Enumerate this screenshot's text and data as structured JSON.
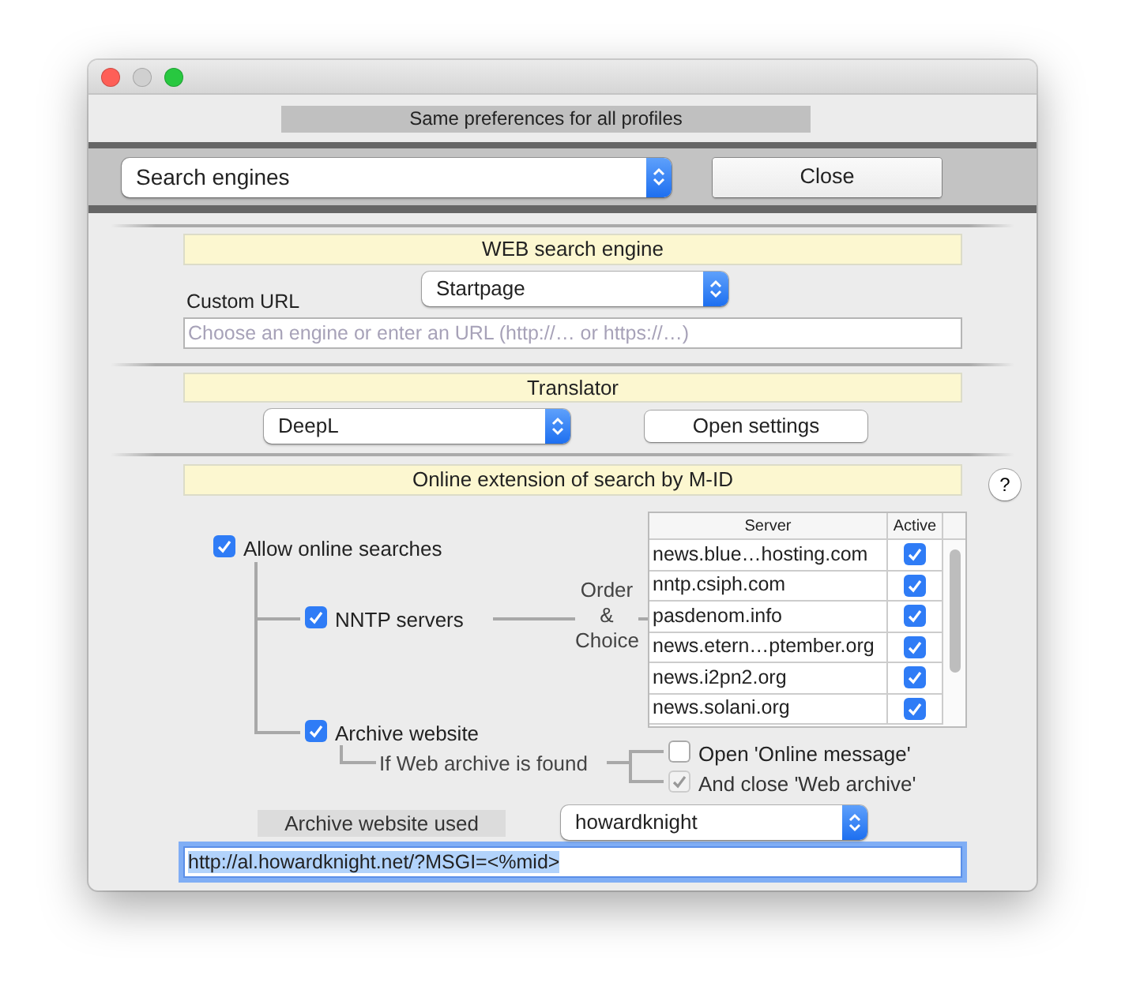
{
  "profile_banner": "Same preferences for all profiles",
  "toolbar": {
    "section_select": "Search engines",
    "close_button": "Close"
  },
  "web_search": {
    "header": "WEB search engine",
    "custom_url_label": "Custom URL",
    "engine_select": "Startpage",
    "url_field": {
      "placeholder": "Choose an engine or enter an URL (http://… or https://…)"
    }
  },
  "translator": {
    "header": "Translator",
    "select": "DeepL",
    "settings_button": "Open settings"
  },
  "online": {
    "header": "Online extension of search by M-ID",
    "help_button": "?",
    "allow": {
      "label": "Allow online searches",
      "checked": true
    },
    "nntp": {
      "label": "NNTP servers",
      "checked": true
    },
    "order_label": "Order & Choice",
    "servers": {
      "columns": [
        "Server",
        "Active"
      ],
      "rows": [
        {
          "server": "news.blue…hosting.com",
          "active": true
        },
        {
          "server": "nntp.csiph.com",
          "active": true
        },
        {
          "server": "pasdenom.info",
          "active": true
        },
        {
          "server": "news.etern…ptember.org",
          "active": true
        },
        {
          "server": "news.i2pn2.org",
          "active": true
        },
        {
          "server": "news.solani.org",
          "active": true
        }
      ]
    },
    "archive": {
      "label": "Archive website",
      "checked": true
    },
    "if_found_label": "If Web archive is found",
    "options": [
      {
        "label": "Open 'Online message'",
        "checked": false,
        "disabled": false
      },
      {
        "label": "And close 'Web archive'",
        "checked": true,
        "disabled": true
      }
    ],
    "archive_used_label": "Archive website used",
    "archive_select": "howardknight",
    "archive_url": {
      "value": "http://al.howardknight.net/?MSGI=<%mid>",
      "focused": true
    }
  }
}
